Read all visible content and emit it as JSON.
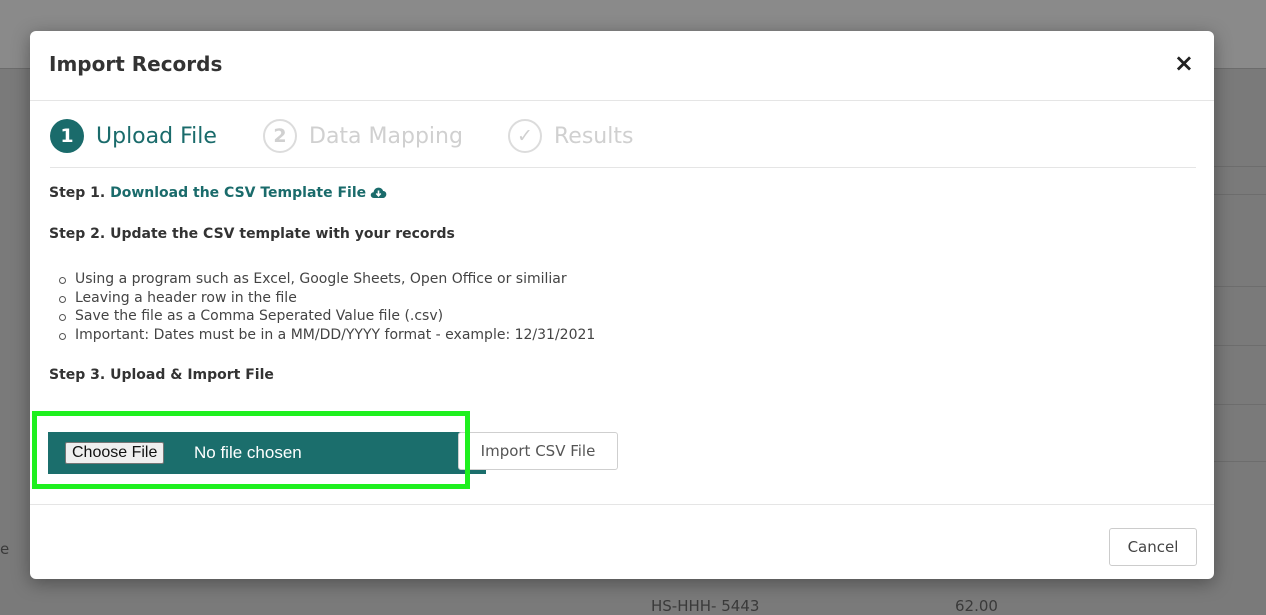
{
  "background": {
    "visible_text_1": "HS-HHH- 5443",
    "visible_text_2": "62.00",
    "left_edge_char": "e"
  },
  "modal": {
    "title": "Import Records",
    "close_label": "×",
    "steps": [
      {
        "number": "1",
        "label": "Upload File",
        "state": "active"
      },
      {
        "number": "2",
        "label": "Data Mapping",
        "state": "inactive"
      },
      {
        "number": "✓",
        "label": "Results",
        "state": "inactive"
      }
    ],
    "step1_prefix": "Step 1.",
    "step1_link": "Download the CSV Template File",
    "step2": "Step 2. Update the CSV template with your records",
    "bullets": [
      "Using a program such as Excel, Google Sheets, Open Office or similiar",
      "Leaving a header row in the file",
      "Save the file as a Comma Seperated Value file (.csv)",
      "Important: Dates must be in a MM/DD/YYYY format - example: 12/31/2021"
    ],
    "step3": "Step 3. Upload & Import File",
    "file_input": {
      "button_label": "Choose File",
      "status": "No file chosen"
    },
    "import_button": "Import CSV File",
    "cancel_button": "Cancel"
  },
  "colors": {
    "accent": "#1a6b6b",
    "highlight": "#1ff01f"
  }
}
